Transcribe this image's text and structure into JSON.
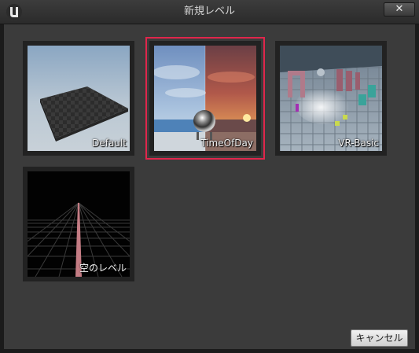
{
  "window": {
    "title": "新規レベル",
    "close_glyph": "✕",
    "logo_icon": "unreal-engine-logo-icon"
  },
  "templates": [
    {
      "label": "Default",
      "selected": false,
      "thumb_icon": "default-level-thumbnail"
    },
    {
      "label": "TimeOfDay",
      "selected": true,
      "thumb_icon": "time-of-day-level-thumbnail"
    },
    {
      "label": "VR-Basic",
      "selected": false,
      "thumb_icon": "vr-basic-level-thumbnail"
    },
    {
      "label": "空のレベル",
      "selected": false,
      "thumb_icon": "empty-level-thumbnail"
    }
  ],
  "footer": {
    "cancel_label": "キャンセル"
  },
  "colors": {
    "selection_outline": "#e0264c",
    "panel_background": "#3b3b3b"
  }
}
